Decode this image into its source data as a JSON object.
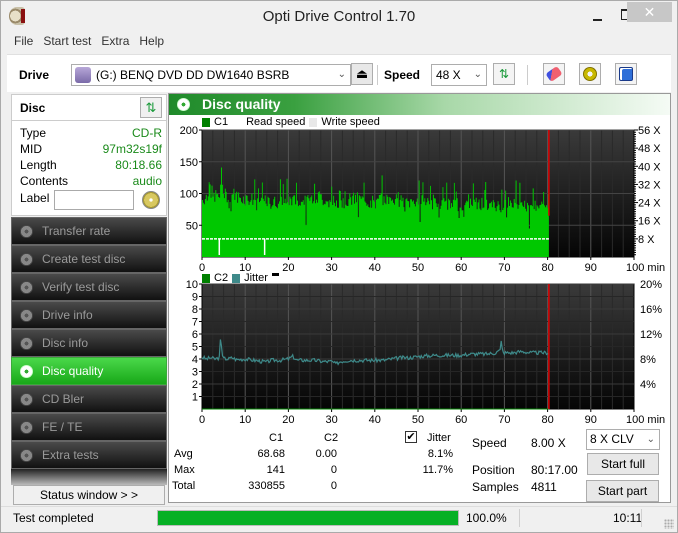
{
  "window": {
    "title": "Opti Drive Control 1.70",
    "close_glyph": "✕"
  },
  "menu": [
    "File",
    "Start test",
    "Extra",
    "Help"
  ],
  "toolbar": {
    "drive_label": "Drive",
    "drive_value": "(G:)   BENQ DVD DD DW1640 BSRB",
    "speed_label": "Speed",
    "speed_value": "48 X",
    "eject_glyph": "⏏",
    "refresh_glyph": "⇅"
  },
  "disc": {
    "header": "Disc",
    "refresh_glyph": "⇅",
    "rows": [
      {
        "key": "Type",
        "value": "CD-R"
      },
      {
        "key": "MID",
        "value": "97m32s19f"
      },
      {
        "key": "Length",
        "value": "80:18.66"
      },
      {
        "key": "Contents",
        "value": "audio"
      }
    ],
    "label_key": "Label",
    "label_value": ""
  },
  "nav": [
    {
      "label": "Transfer rate",
      "active": false
    },
    {
      "label": "Create test disc",
      "active": false
    },
    {
      "label": "Verify test disc",
      "active": false
    },
    {
      "label": "Drive info",
      "active": false
    },
    {
      "label": "Disc info",
      "active": false
    },
    {
      "label": "Disc quality",
      "active": true
    },
    {
      "label": "CD Bler",
      "active": false
    },
    {
      "label": "FE / TE",
      "active": false
    },
    {
      "label": "Extra tests",
      "active": false
    }
  ],
  "status_window_label": "Status window > >",
  "main": {
    "title": "Disc quality",
    "legend_top": {
      "c1": "C1",
      "read": "Read speed",
      "write": "Write speed"
    },
    "legend_bottom": {
      "c2": "C2",
      "jitter": "Jitter"
    }
  },
  "colors": {
    "c1": "#00c800",
    "c2": "#008000",
    "jitter": "#3e8a8a",
    "read_speed": "#ffffff",
    "write_speed": "#e8e8e8",
    "end_marker": "#e00000",
    "progress": "#06b025",
    "value_green": "#1a8a1a"
  },
  "chart_data": [
    {
      "type": "bar",
      "title": "C1 / Read speed",
      "xlabel": "min",
      "x_ticks": [
        0,
        10,
        20,
        30,
        40,
        50,
        60,
        70,
        80,
        90,
        100
      ],
      "x_tick_labels": [
        "0",
        "10",
        "20",
        "30",
        "40",
        "50",
        "60",
        "70",
        "80",
        "90",
        "100 min"
      ],
      "xlim": [
        0,
        100
      ],
      "y_ticks_left": [
        50,
        100,
        150,
        200
      ],
      "ylim_left": [
        0,
        200
      ],
      "y_ticks_right": [
        "8 X",
        "16 X",
        "24 X",
        "32 X",
        "40 X",
        "48 X",
        "56 X"
      ],
      "ylim_right": [
        0,
        56
      ],
      "end_marker_min": 80.3,
      "legend": [
        "C1",
        "Read speed",
        "Write speed"
      ],
      "series": [
        {
          "name": "C1",
          "x_end": 80.3,
          "profile": [
            [
              0,
              90
            ],
            [
              1,
              95
            ],
            [
              2,
              92
            ],
            [
              3,
              97
            ],
            [
              4,
              95
            ],
            [
              4.5,
              120
            ],
            [
              5,
              98
            ],
            [
              6,
              96
            ],
            [
              7,
              100
            ],
            [
              8,
              95
            ],
            [
              9,
              93
            ],
            [
              10,
              92
            ],
            [
              12,
              90
            ],
            [
              14,
              88
            ],
            [
              15,
              86
            ],
            [
              16,
              85
            ],
            [
              18,
              88
            ],
            [
              20,
              90
            ],
            [
              22,
              88
            ],
            [
              24,
              86
            ],
            [
              25,
              92
            ],
            [
              27,
              95
            ],
            [
              28,
              90
            ],
            [
              30,
              88
            ],
            [
              32,
              86
            ],
            [
              34,
              90
            ],
            [
              36,
              92
            ],
            [
              38,
              88
            ],
            [
              40,
              86
            ],
            [
              42,
              92
            ],
            [
              44,
              90
            ],
            [
              46,
              88
            ],
            [
              48,
              86
            ],
            [
              50,
              90
            ],
            [
              52,
              92
            ],
            [
              54,
              88
            ],
            [
              56,
              85
            ],
            [
              58,
              82
            ],
            [
              60,
              84
            ],
            [
              62,
              86
            ],
            [
              64,
              84
            ],
            [
              66,
              82
            ],
            [
              68,
              80
            ],
            [
              70,
              82
            ],
            [
              72,
              86
            ],
            [
              74,
              80
            ],
            [
              76,
              78
            ],
            [
              78,
              85
            ],
            [
              79,
              92
            ],
            [
              80,
              70
            ],
            [
              80.3,
              65
            ]
          ],
          "avg": 68.68,
          "max": 141,
          "total": 330855
        },
        {
          "name": "Read speed",
          "unit": "X",
          "value": 8.0,
          "dropouts_min": [
            4,
            14.5
          ]
        }
      ]
    },
    {
      "type": "line",
      "title": "C2 / Jitter",
      "xlabel": "min",
      "x_ticks": [
        0,
        10,
        20,
        30,
        40,
        50,
        60,
        70,
        80,
        90,
        100
      ],
      "x_tick_labels": [
        "0",
        "10",
        "20",
        "30",
        "40",
        "50",
        "60",
        "70",
        "80",
        "90",
        "100 min"
      ],
      "xlim": [
        0,
        100
      ],
      "y_ticks_left": [
        1,
        2,
        3,
        4,
        5,
        6,
        7,
        8,
        9,
        10
      ],
      "ylim_left": [
        0,
        10
      ],
      "y_ticks_right": [
        "4%",
        "8%",
        "12%",
        "16%",
        "20%"
      ],
      "ylim_right": [
        0,
        20
      ],
      "end_marker_min": 80.3,
      "legend": [
        "C2",
        "Jitter"
      ],
      "series": [
        {
          "name": "C2",
          "values_constant": 0,
          "avg": 0.0,
          "max": 0,
          "total": 0
        },
        {
          "name": "Jitter",
          "unit": "%",
          "points": [
            [
              0,
              8.3
            ],
            [
              1,
              8.0
            ],
            [
              2,
              8.2
            ],
            [
              3,
              8.0
            ],
            [
              4,
              8.2
            ],
            [
              4.3,
              11.7
            ],
            [
              4.7,
              8.6
            ],
            [
              5,
              8.1
            ],
            [
              6,
              8.0
            ],
            [
              7,
              8.2
            ],
            [
              8,
              7.9
            ],
            [
              10,
              8.0
            ],
            [
              12,
              7.8
            ],
            [
              14,
              7.6
            ],
            [
              15,
              7.5
            ],
            [
              16,
              7.8
            ],
            [
              18,
              7.8
            ],
            [
              20,
              8.0
            ],
            [
              21,
              8.4
            ],
            [
              22,
              7.8
            ],
            [
              24,
              7.8
            ],
            [
              26,
              7.8
            ],
            [
              28,
              7.6
            ],
            [
              30,
              7.6
            ],
            [
              31,
              7.2
            ],
            [
              32,
              7.6
            ],
            [
              34,
              7.8
            ],
            [
              36,
              7.8
            ],
            [
              38,
              7.8
            ],
            [
              40,
              7.8
            ],
            [
              42,
              7.8
            ],
            [
              44,
              8.0
            ],
            [
              46,
              8.2
            ],
            [
              48,
              8.2
            ],
            [
              50,
              8.4
            ],
            [
              52,
              8.5
            ],
            [
              54,
              8.6
            ],
            [
              56,
              8.6
            ],
            [
              58,
              8.6
            ],
            [
              60,
              8.6
            ],
            [
              62,
              8.8
            ],
            [
              64,
              8.8
            ],
            [
              66,
              8.8
            ],
            [
              68,
              9.0
            ],
            [
              69,
              9.4
            ],
            [
              69.3,
              11.2
            ],
            [
              69.6,
              9.0
            ],
            [
              70,
              9.0
            ],
            [
              72,
              9.0
            ],
            [
              74,
              9.2
            ],
            [
              76,
              9.0
            ],
            [
              78,
              9.0
            ],
            [
              80,
              9.0
            ],
            [
              80.3,
              9.0
            ]
          ],
          "avg": 8.1,
          "max": 11.7
        }
      ]
    }
  ],
  "stats": {
    "col_c1": "C1",
    "col_c2": "C2",
    "jitter_label": "Jitter",
    "jitter_checked": true,
    "check_glyph": "✔",
    "rows": [
      {
        "label": "Avg",
        "c1": "68.68",
        "c2": "0.00",
        "jitter": "8.1%"
      },
      {
        "label": "Max",
        "c1": "141",
        "c2": "0",
        "jitter": "11.7%"
      },
      {
        "label": "Total",
        "c1": "330855",
        "c2": "0",
        "jitter": ""
      }
    ],
    "speed_label": "Speed",
    "speed_value": "8.00 X",
    "position_label": "Position",
    "position_value": "80:17.00",
    "samples_label": "Samples",
    "samples_value": "4811",
    "mode_value": "8 X CLV",
    "start_full": "Start full",
    "start_part": "Start part"
  },
  "statusbar": {
    "text": "Test completed",
    "progress": 1.0,
    "progress_text": "100.0%",
    "time": "10:11"
  }
}
